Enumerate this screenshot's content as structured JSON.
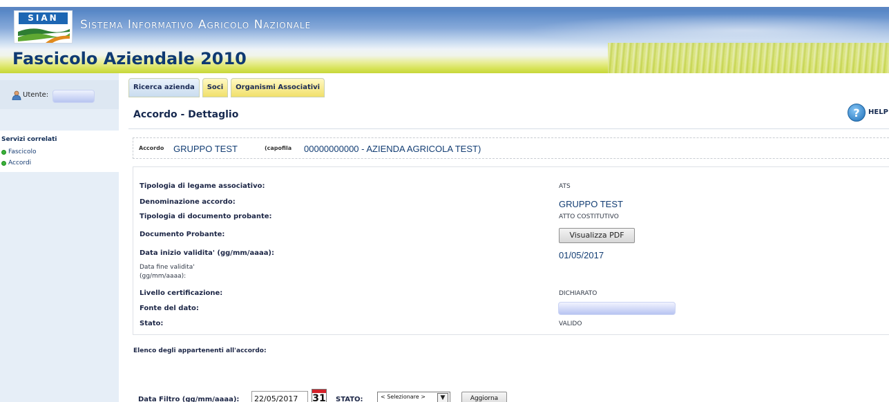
{
  "header": {
    "logo_text": "SIAN",
    "system_title": "Sistema Informativo Agricolo Nazionale",
    "app_title": "Fascicolo Aziendale 2010"
  },
  "sidebar": {
    "user_label": "Utente:",
    "servizi_title": "Servizi correlati",
    "links": [
      {
        "label": "Fascicolo"
      },
      {
        "label": "Accordi"
      }
    ]
  },
  "tabs": [
    {
      "label": "Ricerca azienda",
      "style": "blue"
    },
    {
      "label": "Soci",
      "style": "yellow"
    },
    {
      "label": "Organismi Associativi",
      "style": "yellow"
    }
  ],
  "page": {
    "title": "Accordo - Dettaglio",
    "help_label": "HELP"
  },
  "accordo": {
    "label": "Accordo",
    "name": "GRUPPO TEST",
    "capofila_label": "(capofila",
    "capofila_value": "00000000000 - AZIENDA AGRICOLA TEST)"
  },
  "details": {
    "tipologia_legame_label": "Tipologia di legame associativo:",
    "tipologia_legame_value": "ATS",
    "denominazione_label": "Denominazione accordo:",
    "denominazione_value": "GRUPPO TEST",
    "tipologia_documento_label": "Tipologia di documento probante:",
    "tipologia_documento_value": "ATTO COSTITUTIVO",
    "documento_label": "Documento Probante:",
    "pdf_button": "Visualizza PDF",
    "data_inizio_label": "Data inizio validita' (gg/mm/aaaa):",
    "data_inizio_value": "01/05/2017",
    "data_fine_label_1": "Data fine validita'",
    "data_fine_label_2": "(gg/mm/aaaa):",
    "livello_label": "Livello certificazione:",
    "livello_value": "DICHIARATO",
    "fonte_label": "Fonte del dato:",
    "stato_label": "Stato:",
    "stato_value": "VALIDO"
  },
  "elenco": {
    "title": "Elenco degli appartenenti all'accordo:",
    "filter_label": "Data Filtro (gg/mm/aaaa):",
    "filter_date": "22/05/2017",
    "calendar_day": "31",
    "stato_label": "STATO:",
    "stato_selected": "< Selezionare >",
    "aggiorna_button": "Aggiorna"
  },
  "icons": {
    "user": "user-icon",
    "help": "help-icon",
    "calendar": "calendar-icon",
    "bullet": "green-dot-icon"
  },
  "colors": {
    "banner_blue": "#5686c6",
    "title_navy": "#0f3a72",
    "sidebar_bg": "#e6eef7",
    "tab_yellow": "#f1e06b",
    "tab_blue": "#c9dcef",
    "bullet_green": "#3bb23b"
  }
}
